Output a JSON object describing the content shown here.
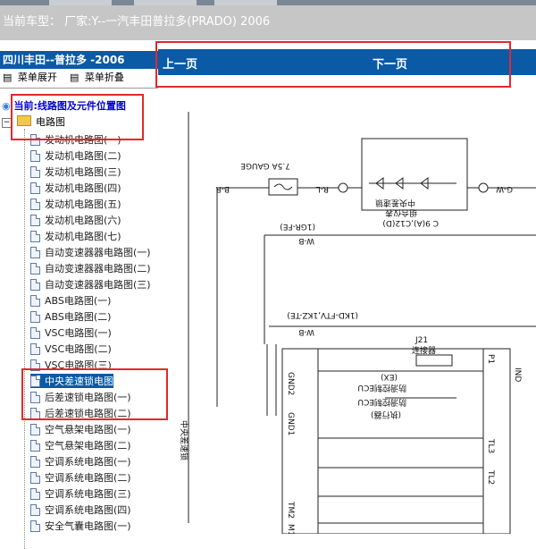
{
  "header": {
    "text": "当前车型： 厂家:Y--一汽丰田普拉多(PRADO) 2006"
  },
  "sidebar": {
    "title": "四川丰田--普拉多 -2006",
    "expand_label": "菜单展开",
    "collapse_label": "菜单折叠",
    "root_label": "当前:线路图及元件位置图",
    "folder_label": "电路图",
    "items": [
      {
        "label": "发动机电路图(一)"
      },
      {
        "label": "发动机电路图(二)"
      },
      {
        "label": "发动机电路图(三)"
      },
      {
        "label": "发动机电路图(四)"
      },
      {
        "label": "发动机电路图(五)"
      },
      {
        "label": "发动机电路图(六)"
      },
      {
        "label": "发动机电路图(七)"
      },
      {
        "label": "自动变速器器电路图(一)"
      },
      {
        "label": "自动变速器器电路图(二)"
      },
      {
        "label": "自动变速器器电路图(三)"
      },
      {
        "label": "ABS电路图(一)"
      },
      {
        "label": "ABS电路图(二)"
      },
      {
        "label": "VSC电路图(一)"
      },
      {
        "label": "VSC电路图(二)"
      },
      {
        "label": "VSC电路图(三)"
      },
      {
        "label": "中央差速锁电图"
      },
      {
        "label": "后差速锁电路图(一)"
      },
      {
        "label": "后差速锁电路图(二)"
      },
      {
        "label": "空气悬架电路图(一)"
      },
      {
        "label": "空气悬架电路图(二)"
      },
      {
        "label": "空调系统电路图(一)"
      },
      {
        "label": "空调系统电路图(二)"
      },
      {
        "label": "空调系统电路图(三)"
      },
      {
        "label": "空调系统电路图(四)"
      },
      {
        "label": "安全气囊电路图(一)"
      }
    ]
  },
  "nav": {
    "prev": "上一页",
    "next": "下一页"
  },
  "diagram": {
    "gauge": "7.5A GAUGE",
    "br": "B-R",
    "rl": "R-L",
    "gw": "G-W",
    "combo": "组合仪表",
    "combo_sub": "中央差速锁",
    "c9": "C 9(A),C12(D)",
    "wb": "W-B",
    "igr": "(1GR-FE)",
    "ikd": "(1KD-FTV,1KZ-TE)",
    "j21": "J21",
    "conn": "连接器",
    "ecu1": "防滑控制ECU",
    "ecu1_sub": "(EX)",
    "ecu2": "防滑控制ECU",
    "motor": "(执行器)",
    "side": "中央差速锁",
    "pins": [
      "GND2",
      "GND1",
      "TL3",
      "TL2",
      "TM2",
      "M1",
      "IND",
      "P1"
    ]
  }
}
